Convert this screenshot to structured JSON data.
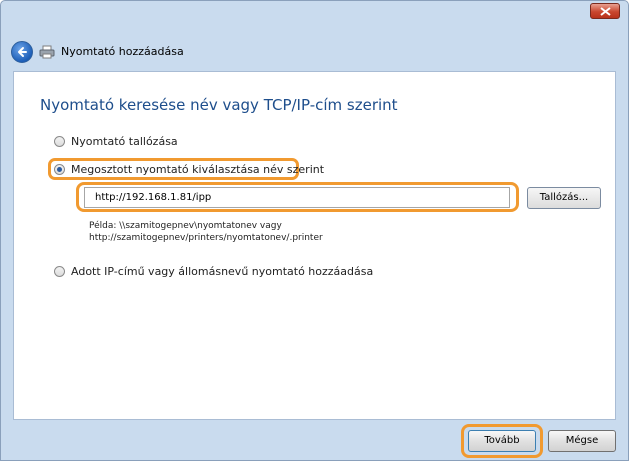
{
  "window": {
    "close_icon": "close-icon",
    "title": "Nyomtató hozzáadása"
  },
  "nav": {
    "back_icon": "back-arrow-icon",
    "printer_icon": "printer-icon"
  },
  "main": {
    "heading": "Nyomtató keresése név vagy TCP/IP-cím szerint",
    "options": [
      {
        "label": "Nyomtató tallózása",
        "selected": false
      },
      {
        "label": "Megosztott nyomtató kiválasztása név szerint",
        "selected": true
      },
      {
        "label": "Adott IP-című vagy állomásnevű nyomtató hozzáadása",
        "selected": false
      }
    ],
    "url_value": "http://192.168.1.81/ipp",
    "browse_label": "Tallózás...",
    "example_line1": "Példa: \\\\szamitogepnev\\nyomtatonev vagy",
    "example_line2": "http://szamitogepnev/printers/nyomtatonev/.printer"
  },
  "footer": {
    "next_label": "Tovább",
    "cancel_label": "Mégse"
  },
  "colors": {
    "highlight": "#f19a30",
    "heading": "#1e4e8c",
    "frame": "#c9dbee"
  }
}
